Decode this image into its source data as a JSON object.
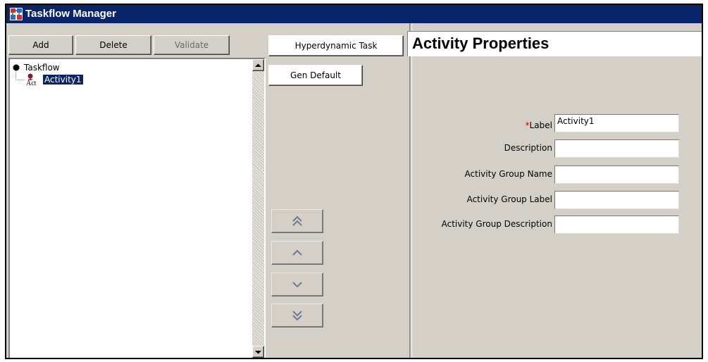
{
  "window": {
    "title": "Taskflow Manager"
  },
  "toolbar": {
    "add_label": "Add",
    "delete_label": "Delete",
    "validate_label": "Validate"
  },
  "tree": {
    "root_label": "Taskflow",
    "items": [
      {
        "icon_text": "Act",
        "label": "Activity1",
        "selected": true
      }
    ]
  },
  "middle": {
    "hyperdynamic_label": "Hyperdynamic Task",
    "gen_default_label": "Gen Default",
    "move_buttons": [
      "move-top",
      "move-up",
      "move-down",
      "move-bottom"
    ]
  },
  "properties": {
    "title": "Activity Properties",
    "fields": [
      {
        "label": "Label",
        "required": true,
        "required_marker": "*",
        "value": "Activity1"
      },
      {
        "label": "Description",
        "required": false,
        "value": ""
      },
      {
        "label": "Activity Group Name",
        "required": false,
        "value": ""
      },
      {
        "label": "Activity Group Label",
        "required": false,
        "value": ""
      },
      {
        "label": "Activity Group Description",
        "required": false,
        "value": ""
      }
    ]
  },
  "colors": {
    "title_bar": "#0a246a",
    "panel_bg": "#d4d0c8",
    "selection": "#0a246a",
    "required": "#cc0000"
  }
}
